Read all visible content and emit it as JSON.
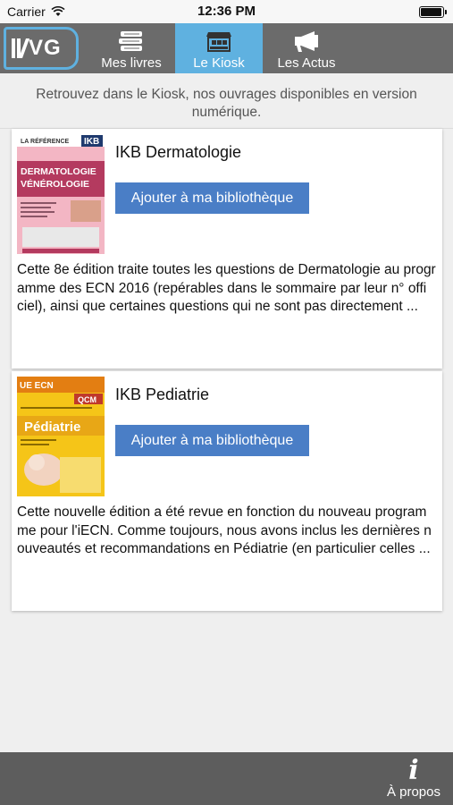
{
  "status_bar": {
    "carrier": "Carrier",
    "time": "12:36 PM",
    "battery_level": 0.95
  },
  "nav": {
    "logo_text": "VG",
    "tabs": [
      {
        "label": "Mes livres",
        "icon": "books-stack-icon",
        "active": false
      },
      {
        "label": "Le Kiosk",
        "icon": "kiosk-stand-icon",
        "active": true
      },
      {
        "label": "Les Actus",
        "icon": "megaphone-icon",
        "active": false
      }
    ]
  },
  "intro_text": "Retrouvez dans le Kiosk, nos ouvrages disponibles en version numérique.",
  "books": [
    {
      "title": "IKB Dermatologie",
      "button_label": "Ajouter à ma bibliothèque",
      "description": "Cette 8e édition traite toutes les questions de Dermatologie au programme des ECN 2016 (repérables dans le sommaire par leur n° offi ciel), ainsi que certaines questions qui ne sont pas directement ...",
      "cover": {
        "series": "LA RÉFÉRENCE",
        "badge": "IKB",
        "title_line1": "DERMATOLOGIE",
        "title_line2": "VÉNÉROLOGIE",
        "bg_color": "#f3b6c4",
        "band_color": "#b43a5f"
      }
    },
    {
      "title": "IKB Pediatrie",
      "button_label": "Ajouter à ma bibliothèque",
      "description": "Cette nouvelle édition a été revue en fonction du nouveau programme pour l'iECN. Comme toujours, nous avons inclus les dernières nouveautés et recommandations en Pédiatrie (en particulier celles ...",
      "cover": {
        "series": "UE ECN",
        "badge": "QCM",
        "title_line1": "Pédiatrie",
        "bg_color": "#f5c518",
        "band_color": "#e37e12"
      }
    }
  ],
  "bottom_bar": {
    "about_label": "À propos",
    "about_icon": "info-icon"
  },
  "colors": {
    "accent": "#5fb1e0",
    "button": "#4a7ec6",
    "nav_bg": "#6b6b6b",
    "bottom_bg": "#5d5d5d"
  }
}
